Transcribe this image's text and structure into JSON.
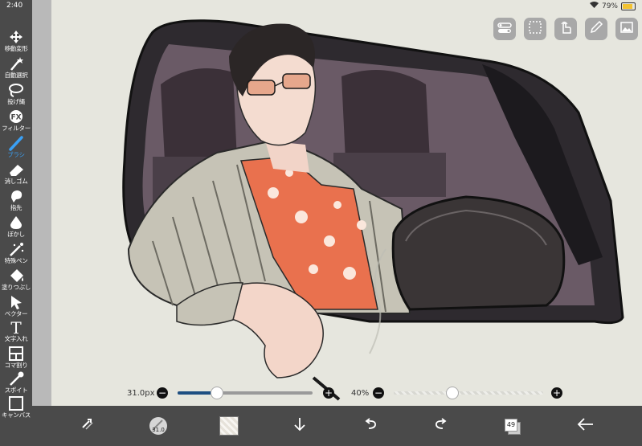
{
  "status": {
    "time": "2:40",
    "battery": "79%"
  },
  "tools": [
    {
      "label": "移動変形",
      "icon": "move-icon"
    },
    {
      "label": "自動選択",
      "icon": "magic-wand-icon"
    },
    {
      "label": "投げ縄",
      "icon": "lasso-icon"
    },
    {
      "label": "フィルター",
      "icon": "fx-icon"
    },
    {
      "label": "ブラシ",
      "icon": "brush-icon",
      "active": true
    },
    {
      "label": "消しゴム",
      "icon": "eraser-icon"
    },
    {
      "label": "指先",
      "icon": "finger-icon"
    },
    {
      "label": "ぼかし",
      "icon": "blur-icon"
    },
    {
      "label": "特殊ペン",
      "icon": "special-pen-icon"
    },
    {
      "label": "塗りつぶし",
      "icon": "fill-icon"
    },
    {
      "label": "ベクター",
      "icon": "vector-icon"
    },
    {
      "label": "文字入れ",
      "icon": "text-icon"
    },
    {
      "label": "コマ割り",
      "icon": "frame-icon"
    },
    {
      "label": "スポイト",
      "icon": "eyedropper-icon"
    },
    {
      "label": "キャンバス",
      "icon": "canvas-icon"
    }
  ],
  "brush_size": {
    "label": "31.0px",
    "level": 0.29
  },
  "opacity": {
    "label": "40%",
    "level": 0.39
  },
  "bottom": {
    "brush_badge": "31.0",
    "pages": "49"
  },
  "colors": {
    "accent": "#3aa0f5",
    "toolbar": "#4a4a4a",
    "track_fill": "#1e4f82"
  }
}
